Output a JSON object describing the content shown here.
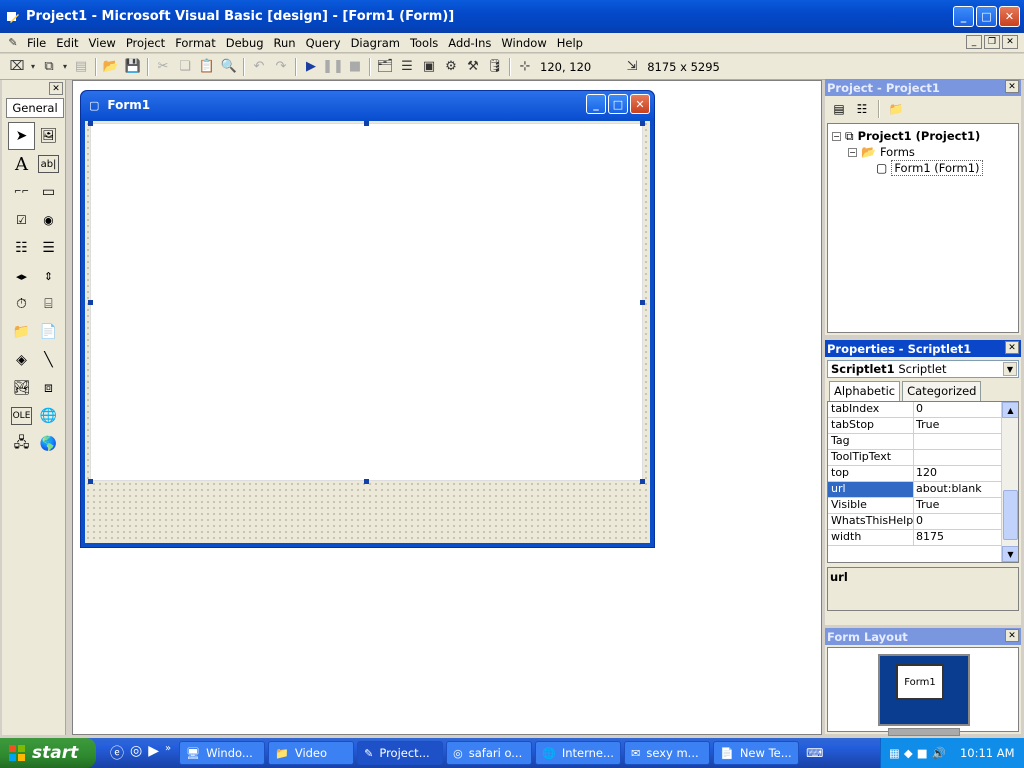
{
  "window": {
    "title": "Project1 - Microsoft Visual Basic [design] - [Form1 (Form)]"
  },
  "menu": [
    "File",
    "Edit",
    "View",
    "Project",
    "Format",
    "Debug",
    "Run",
    "Query",
    "Diagram",
    "Tools",
    "Add-Ins",
    "Window",
    "Help"
  ],
  "toolbar": {
    "position": "120, 120",
    "size": "8175 x 5295"
  },
  "toolbox": {
    "tab": "General"
  },
  "form": {
    "title": "Form1"
  },
  "project": {
    "title": "Project - Project1",
    "root": "Project1 (Project1)",
    "folder": "Forms",
    "item": "Form1 (Form1)"
  },
  "properties": {
    "title": "Properties - Scriptlet1",
    "object_name": "Scriptlet1",
    "object_type": "Scriptlet",
    "tabs": [
      "Alphabetic",
      "Categorized"
    ],
    "rows": [
      {
        "name": "tabIndex",
        "value": "0"
      },
      {
        "name": "tabStop",
        "value": "True"
      },
      {
        "name": "Tag",
        "value": ""
      },
      {
        "name": "ToolTipText",
        "value": ""
      },
      {
        "name": "top",
        "value": "120"
      },
      {
        "name": "url",
        "value": "about:blank"
      },
      {
        "name": "Visible",
        "value": "True"
      },
      {
        "name": "WhatsThisHelpID",
        "value": "0"
      },
      {
        "name": "width",
        "value": "8175"
      }
    ],
    "description": "url"
  },
  "form_layout": {
    "title": "Form Layout",
    "mini_label": "Form1"
  },
  "taskbar": {
    "start": "start",
    "tasks": [
      "Windo...",
      "Video",
      "Project...",
      "safari o...",
      "Interne...",
      "sexy m...",
      "New Te..."
    ],
    "clock": "10:11 AM"
  }
}
